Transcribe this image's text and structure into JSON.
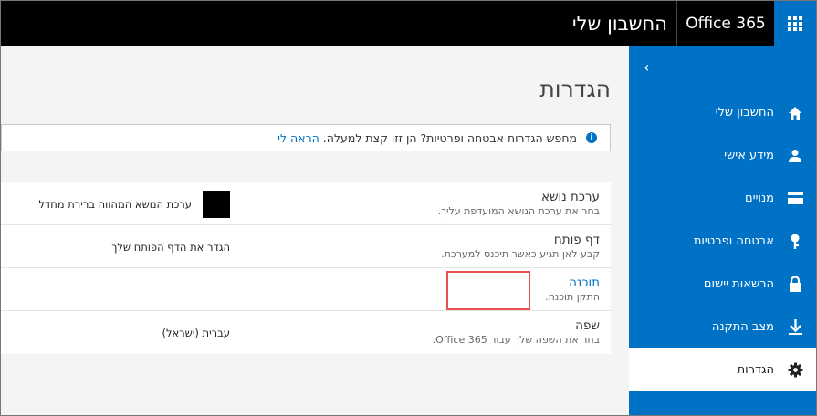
{
  "topbar": {
    "brand": "Office 365",
    "title": "החשבון שלי",
    "waffle_icon": "app-launcher-icon"
  },
  "sidebar": {
    "collapse_icon": "chevron-right-icon",
    "items": [
      {
        "label": "החשבון שלי",
        "icon": "home-icon"
      },
      {
        "label": "מידע אישי",
        "icon": "person-icon"
      },
      {
        "label": "מנויים",
        "icon": "card-icon"
      },
      {
        "label": "אבטחה ופרטיות",
        "icon": "key-icon"
      },
      {
        "label": "הרשאות יישום",
        "icon": "lock-icon"
      },
      {
        "label": "מצב התקנה",
        "icon": "download-icon"
      },
      {
        "label": "הגדרות",
        "icon": "gear-icon",
        "active": true
      }
    ]
  },
  "main": {
    "title": "הגדרות",
    "notice": {
      "text": "מחפש הגדרות אבטחה ופרטיות? הן זזו קצת למעלה.",
      "link": "הראה לי"
    },
    "rows": [
      {
        "title": "ערכת נושא",
        "desc": "בחר את ערכת הנושא המועדפת עליך.",
        "value": "ערכת הנושא המהווה ברירת מחדל"
      },
      {
        "title": "דף פותח",
        "desc": "קבע לאן תגיע כאשר תיכנס למערכת.",
        "value": "הגדר את הדף הפותח שלך"
      },
      {
        "title": "תוכנה",
        "desc": "התקן תוכנה.",
        "value": ""
      },
      {
        "title": "שפה",
        "desc": "בחר את השפה שלך עבור Office 365.",
        "value": "עברית (ישראל)"
      }
    ]
  },
  "colors": {
    "accent": "#0072c6",
    "topbar": "#000000",
    "highlight": "#e85050"
  }
}
